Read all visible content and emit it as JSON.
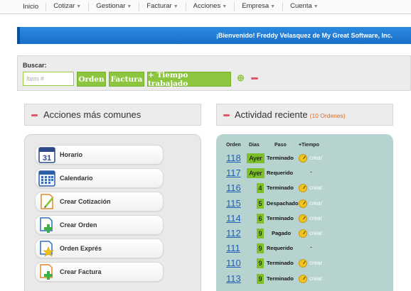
{
  "nav": [
    {
      "label": "Inicio",
      "dropdown": false
    },
    {
      "label": "Cotizar",
      "dropdown": true
    },
    {
      "label": "Gestionar",
      "dropdown": true
    },
    {
      "label": "Facturar",
      "dropdown": true
    },
    {
      "label": "Acciones",
      "dropdown": true
    },
    {
      "label": "Empresa",
      "dropdown": true
    },
    {
      "label": "Cuenta",
      "dropdown": true
    }
  ],
  "nav_arrow": "▼",
  "welcome": "¡Bienvenido! Freddy Velasquez de My Great Software, Inc.",
  "search": {
    "label": "Buscar:",
    "placeholder": "Item #",
    "orden_button": "Orden",
    "factura_button": "Factura",
    "tiempo_button": "+ Tiempo trabajado",
    "add_icon": "plus-icon",
    "remove_icon": "minus-icon"
  },
  "left_section": {
    "title": "Acciones más comunes",
    "actions": [
      {
        "label": "Horario",
        "icon": "schedule-calendar-icon"
      },
      {
        "label": "Calendario",
        "icon": "calendar-grid-icon"
      },
      {
        "label": "Crear Cotización",
        "icon": "create-quote-icon"
      },
      {
        "label": "Crear Orden",
        "icon": "create-order-icon"
      },
      {
        "label": "Orden Exprés",
        "icon": "express-order-icon"
      },
      {
        "label": "Crear Factura",
        "icon": "create-invoice-icon"
      }
    ],
    "calendar_day": "31"
  },
  "right_section": {
    "title": "Actividad reciente",
    "count": "(10 Ordenes)",
    "headers": {
      "orden": "Orden",
      "dias": "Dias",
      "paso": "Paso",
      "tiempo": "+Tiempo"
    },
    "rows": [
      {
        "orden": "118",
        "dias": "Ayer",
        "paso": "Terminado",
        "tiempo": "crear"
      },
      {
        "orden": "117",
        "dias": "Ayer",
        "paso": "Requerido",
        "tiempo": "-"
      },
      {
        "orden": "116",
        "dias": "4",
        "paso": "Terminado",
        "tiempo": "crear"
      },
      {
        "orden": "115",
        "dias": "5",
        "paso": "Despachado",
        "tiempo": "crear"
      },
      {
        "orden": "114",
        "dias": "6",
        "paso": "Terminado",
        "tiempo": "crear"
      },
      {
        "orden": "112",
        "dias": "9",
        "paso": "Pagado",
        "tiempo": "crear"
      },
      {
        "orden": "111",
        "dias": "9",
        "paso": "Requerido",
        "tiempo": "-"
      },
      {
        "orden": "110",
        "dias": "9",
        "paso": "Terminado",
        "tiempo": "crear"
      },
      {
        "orden": "113",
        "dias": "9",
        "paso": "Terminado",
        "tiempo": "crear"
      }
    ]
  },
  "colors": {
    "accent_green": "#8cc63f",
    "welcome_blue": "#1b6fc8",
    "activity_panel": "#b7d3cf",
    "link_blue": "#1f5fb5",
    "count_orange": "#e06a20",
    "minus_red": "#e0566b"
  }
}
